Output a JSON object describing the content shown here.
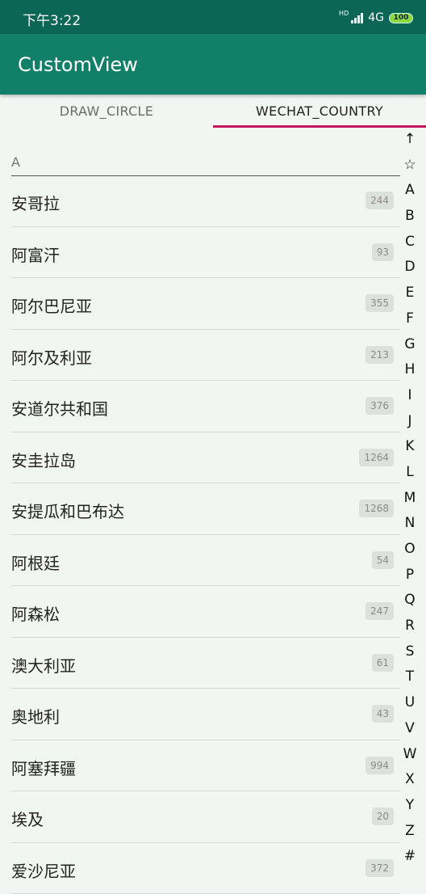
{
  "status": {
    "time": "下午3:22",
    "hd": "HD",
    "network": "4G",
    "battery": "100"
  },
  "app_bar": {
    "title": "CustomView"
  },
  "tabs": [
    {
      "label": "DRAW_CIRCLE"
    },
    {
      "label": "WECHAT_COUNTRY"
    }
  ],
  "section": {
    "letter": "A"
  },
  "rows": [
    {
      "name": "安哥拉",
      "count": "244"
    },
    {
      "name": "阿富汗",
      "count": "93"
    },
    {
      "name": "阿尔巴尼亚",
      "count": "355"
    },
    {
      "name": "阿尔及利亚",
      "count": "213"
    },
    {
      "name": "安道尔共和国",
      "count": "376"
    },
    {
      "name": "安圭拉岛",
      "count": "1264"
    },
    {
      "name": "安提瓜和巴布达",
      "count": "1268"
    },
    {
      "name": "阿根廷",
      "count": "54"
    },
    {
      "name": "阿森松",
      "count": "247"
    },
    {
      "name": "澳大利亚",
      "count": "61"
    },
    {
      "name": "奥地利",
      "count": "43"
    },
    {
      "name": "阿塞拜疆",
      "count": "994"
    },
    {
      "name": "埃及",
      "count": "20"
    },
    {
      "name": "爱沙尼亚",
      "count": "372"
    }
  ],
  "index": [
    "↑",
    "☆",
    "A",
    "B",
    "C",
    "D",
    "E",
    "F",
    "G",
    "H",
    "I",
    "J",
    "K",
    "L",
    "M",
    "N",
    "O",
    "P",
    "Q",
    "R",
    "S",
    "T",
    "U",
    "V",
    "W",
    "X",
    "Y",
    "Z",
    "#"
  ]
}
